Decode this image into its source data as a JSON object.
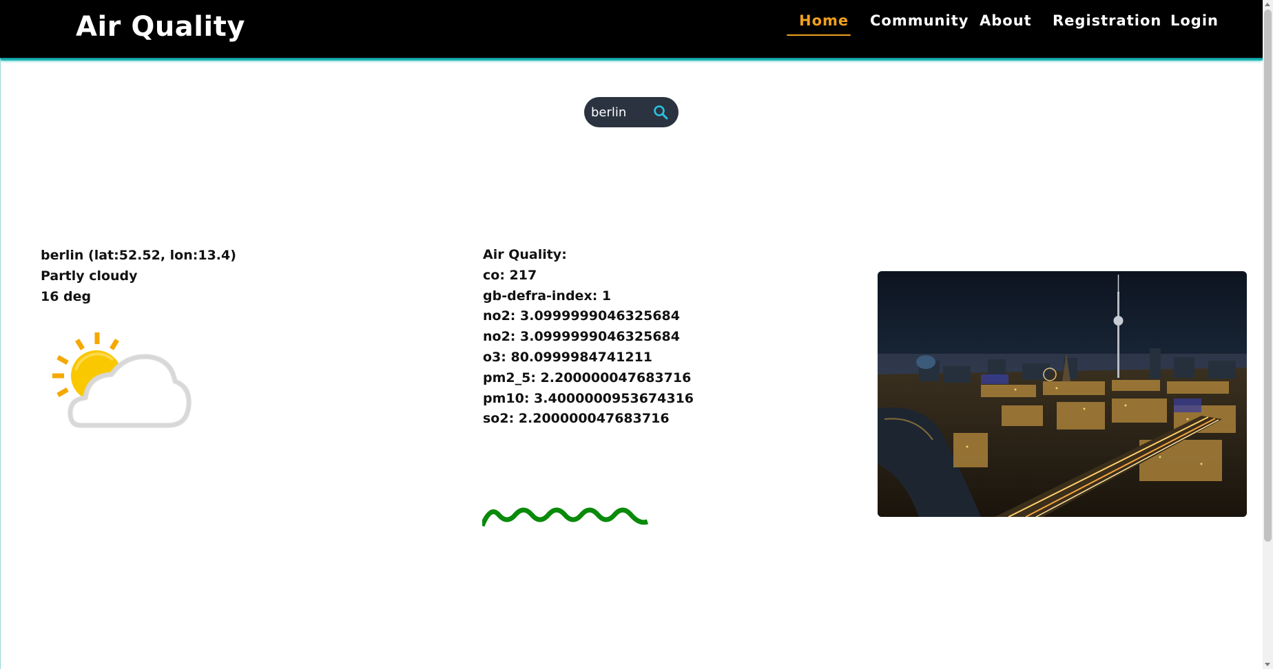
{
  "app": {
    "brand": "Air Quality"
  },
  "nav": {
    "items": [
      {
        "label": "Home",
        "active": true
      },
      {
        "label": "Community",
        "active": false
      },
      {
        "label": "About",
        "active": false
      },
      {
        "label": "Registration",
        "active": false
      },
      {
        "label": "Login",
        "active": false
      }
    ]
  },
  "search": {
    "value": "berlin",
    "icon": "search-icon"
  },
  "location": {
    "title": "berlin (lat:52.52, lon:13.4)",
    "condition": "Partly cloudy",
    "temperature": "16 deg",
    "weather_icon": "partly-cloudy-icon"
  },
  "air_quality": {
    "heading": "Air Quality:",
    "rows": [
      "co: 217",
      "gb-defra-index: 1",
      "no2: 3.0999999046325684",
      "no2: 3.0999999046325684",
      "o3: 80.0999984741211",
      "pm2_5: 2.200000047683716",
      "pm10: 3.4000000953674316",
      "so2: 2.200000047683716"
    ],
    "indicator_color": "#0a8a0a"
  },
  "colors": {
    "header_bg": "#000000",
    "accent_teal": "#29c3c3",
    "active_nav": "#f0a020",
    "search_bg": "#2b3340",
    "search_icon": "#29c3e0"
  }
}
